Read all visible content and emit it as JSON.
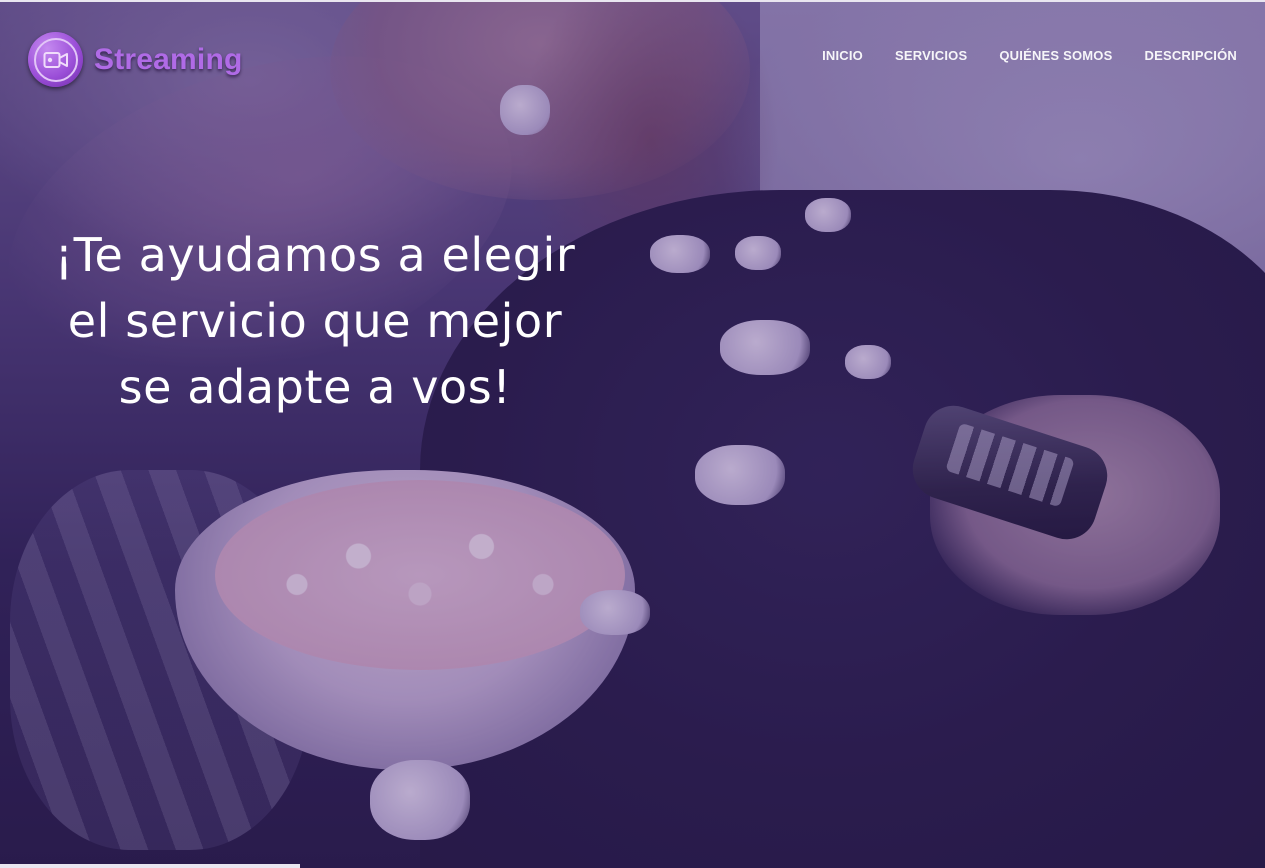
{
  "header": {
    "logo_icon": "video-camera-icon",
    "logo_text": "Streaming",
    "nav": [
      {
        "label": "INICIO"
      },
      {
        "label": "SERVICIOS"
      },
      {
        "label": "QUIÉNES SOMOS"
      },
      {
        "label": "DESCRIPCIÓN"
      }
    ]
  },
  "hero": {
    "lines": [
      "¡Te ayudamos a elegir",
      "el servicio que mejor",
      "se adapte a vos!"
    ]
  },
  "colors": {
    "accent": "#b06be6",
    "overlay": "#3c1e6e",
    "text": "#ffffff"
  }
}
